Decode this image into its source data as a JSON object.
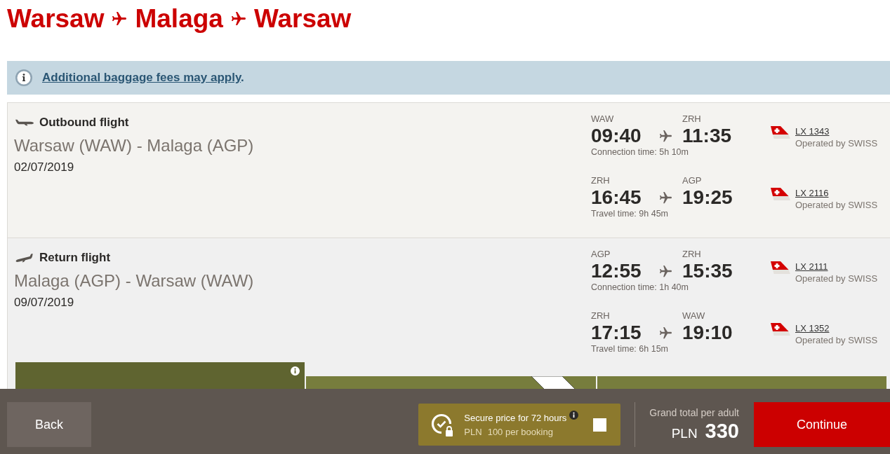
{
  "title": {
    "cities": [
      "Warsaw",
      "Malaga",
      "Warsaw"
    ]
  },
  "notice": {
    "link": "Additional baggage fees may apply",
    "suffix": "."
  },
  "flights": [
    {
      "kind": "outbound",
      "heading": "Outbound flight",
      "route": "Warsaw (WAW) - Malaga (AGP)",
      "date": "02/07/2019",
      "segments": [
        {
          "from": "WAW",
          "depart": "09:40",
          "to": "ZRH",
          "arrive": "11:35",
          "note": "Connection time: 5h 10m",
          "flight_number": "LX 1343",
          "operator": "Operated by SWISS"
        },
        {
          "from": "ZRH",
          "depart": "16:45",
          "to": "AGP",
          "arrive": "19:25",
          "note": "Travel time: 9h 45m",
          "flight_number": "LX 2116",
          "operator": "Operated by SWISS"
        }
      ]
    },
    {
      "kind": "return",
      "heading": "Return flight",
      "route": "Malaga (AGP) - Warsaw (WAW)",
      "date": "09/07/2019",
      "segments": [
        {
          "from": "AGP",
          "depart": "12:55",
          "to": "ZRH",
          "arrive": "15:35",
          "note": "Connection time: 1h 40m",
          "flight_number": "LX 2111",
          "operator": "Operated by SWISS"
        },
        {
          "from": "ZRH",
          "depart": "17:15",
          "to": "WAW",
          "arrive": "19:10",
          "note": "Travel time: 6h 15m",
          "flight_number": "LX 1352",
          "operator": "Operated by SWISS"
        }
      ]
    }
  ],
  "fare_cards": [
    {
      "kind": "featured"
    },
    {
      "kind": "ribbon"
    },
    {
      "kind": "plain"
    }
  ],
  "footer": {
    "back": "Back",
    "secure_price": {
      "title": "Secure price for 72 hours",
      "currency": "PLN",
      "price": "100 per booking",
      "checked": false
    },
    "total": {
      "label": "Grand total per adult",
      "currency": "PLN",
      "amount": "330"
    },
    "continue": "Continue"
  }
}
